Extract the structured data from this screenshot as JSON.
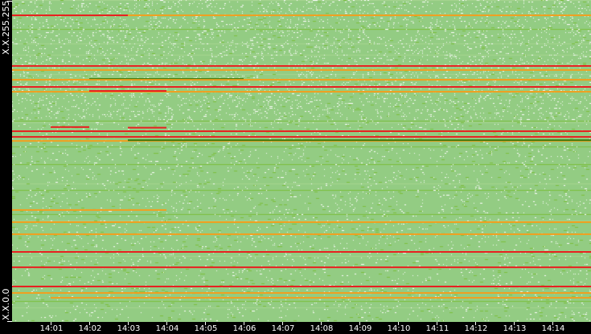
{
  "chart_data": {
    "type": "heatmap",
    "title": "",
    "xlabel": "",
    "ylabel": "",
    "x_domain": [
      "14:00",
      "14:15"
    ],
    "x_ticks": [
      "14:01",
      "14:02",
      "14:03",
      "14:04",
      "14:05",
      "14:06",
      "14:07",
      "14:08",
      "14:09",
      "14:10",
      "14:11",
      "14:12",
      "14:13",
      "14:14"
    ],
    "y_labels": {
      "top": "X.X.255.255",
      "bottom": "X.X.0.0"
    },
    "y_domain": [
      0,
      255
    ],
    "colors": {
      "background": "#93cc83",
      "low": "#7cbf3c",
      "mid": "#f0a020",
      "high": "#e82020",
      "dark": "#3a7a10",
      "empty": "#ffffff"
    },
    "highlight_rows": [
      {
        "row": 243.5,
        "level": "mid",
        "start": "14:00",
        "end": "14:15"
      },
      {
        "row": 243.5,
        "level": "high",
        "start": "14:00",
        "end": "14:03"
      },
      {
        "row": 203.4,
        "level": "high",
        "start": "14:00",
        "end": "14:15"
      },
      {
        "row": 200.2,
        "level": "mid",
        "start": "14:00",
        "end": "14:15"
      },
      {
        "row": 192.5,
        "level": "mid",
        "start": "14:00",
        "end": "14:15"
      },
      {
        "row": 193.1,
        "level": "dark",
        "start": "14:02",
        "end": "14:06"
      },
      {
        "row": 186.8,
        "level": "high",
        "start": "14:00",
        "end": "14:15"
      },
      {
        "row": 192.4,
        "level": "mid",
        "start": "14:00",
        "end": "14:15"
      },
      {
        "row": 183.0,
        "level": "mid",
        "start": "14:00",
        "end": "14:15"
      },
      {
        "row": 183.6,
        "level": "high",
        "start": "14:02",
        "end": "14:04"
      },
      {
        "row": 155.0,
        "level": "high",
        "start": "14:01",
        "end": "14:02"
      },
      {
        "row": 154.5,
        "level": "high",
        "start": "14:03",
        "end": "14:04"
      },
      {
        "row": 151.7,
        "level": "high",
        "start": "14:00",
        "end": "14:15"
      },
      {
        "row": 147.2,
        "level": "high",
        "start": "14:00",
        "end": "14:15"
      },
      {
        "row": 144.0,
        "level": "mid",
        "start": "14:00",
        "end": "14:15"
      },
      {
        "row": 144.6,
        "level": "dark",
        "start": "14:03",
        "end": "14:15"
      },
      {
        "row": 89.3,
        "level": "mid",
        "start": "14:00",
        "end": "14:04"
      },
      {
        "row": 79.7,
        "level": "mid",
        "start": "14:00",
        "end": "14:15"
      },
      {
        "row": 70.1,
        "level": "mid",
        "start": "14:00",
        "end": "14:15"
      },
      {
        "row": 56.1,
        "level": "high",
        "start": "14:00",
        "end": "14:15"
      },
      {
        "row": 43.9,
        "level": "high",
        "start": "14:00",
        "end": "14:15"
      },
      {
        "row": 28.7,
        "level": "high",
        "start": "14:00",
        "end": "14:15"
      },
      {
        "row": 23.6,
        "level": "mid",
        "start": "14:00",
        "end": "14:15"
      },
      {
        "row": 19.8,
        "level": "mid",
        "start": "14:01",
        "end": "14:15"
      }
    ]
  }
}
